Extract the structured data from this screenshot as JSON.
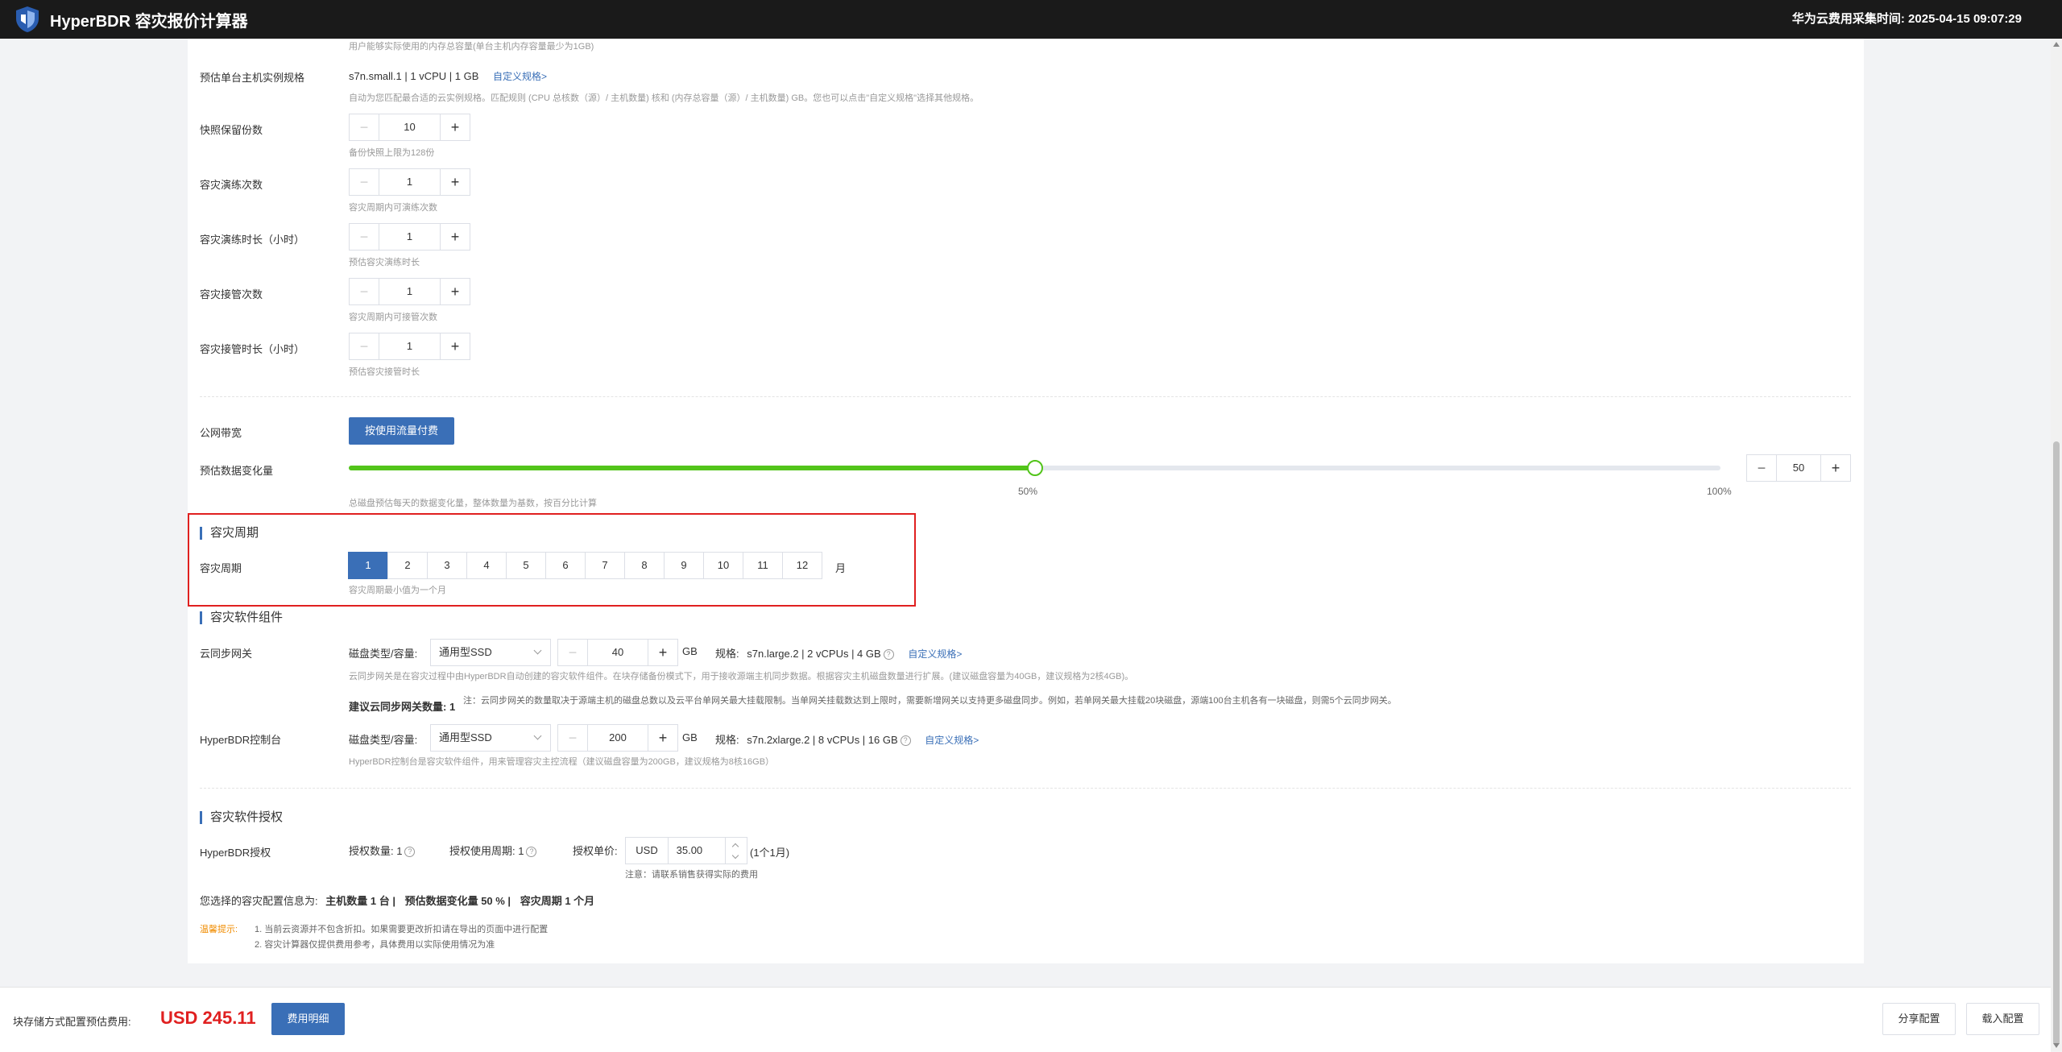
{
  "header": {
    "title": "HyperBDR 容灾报价计算器",
    "collect_time": "华为云费用采集时间: 2025-04-15 09:07:29"
  },
  "memory_hint": "用户能够实际使用的内存总容量(单台主机内存容量最少为1GB)",
  "instance": {
    "label": "预估单台主机实例规格",
    "value": "s7n.small.1 | 1 vCPU | 1 GB",
    "link": "自定义规格>",
    "hint": "自动为您匹配最合适的云实例规格。匹配规则 (CPU 总核数（源）/ 主机数量) 核和 (内存总容量（源）/ 主机数量) GB。您也可以点击\"自定义规格\"选择其他规格。"
  },
  "fields": [
    {
      "label": "快照保留份数",
      "value": "10",
      "hint": "备份快照上限为128份"
    },
    {
      "label": "容灾演练次数",
      "value": "1",
      "hint": "容灾周期内可演练次数"
    },
    {
      "label": "容灾演练时长（小时）",
      "value": "1",
      "hint": "预估容灾演练时长"
    },
    {
      "label": "容灾接管次数",
      "value": "1",
      "hint": "容灾周期内可接管次数"
    },
    {
      "label": "容灾接管时长（小时）",
      "value": "1",
      "hint": "预估容灾接管时长"
    }
  ],
  "bandwidth": {
    "label": "公网带宽",
    "button": "按使用流量付费"
  },
  "change_rate": {
    "label": "预估数据变化量",
    "percent": 50,
    "value": "50",
    "mid_label": "50%",
    "max_label": "100%",
    "hint": "总磁盘预估每天的数据变化量，整体数量为基数，按百分比计算"
  },
  "period_section": {
    "title": "容灾周期",
    "label": "容灾周期",
    "options": [
      "1",
      "2",
      "3",
      "4",
      "5",
      "6",
      "7",
      "8",
      "9",
      "10",
      "11",
      "12"
    ],
    "selected": "1",
    "unit": "月",
    "hint": "容灾周期最小值为一个月"
  },
  "components": {
    "title": "容灾软件组件",
    "gateway": {
      "label": "云同步网关",
      "disk_label": "磁盘类型/容量:",
      "disk_type": "通用型SSD",
      "size": "40",
      "unit": "GB",
      "spec_label": "规格:",
      "spec": "s7n.large.2 | 2 vCPUs | 4 GB",
      "link": "自定义规格>",
      "hint": "云同步网关是在容灾过程中由HyperBDR自动创建的容灾软件组件。在块存储备份模式下，用于接收源端主机同步数据。根据容灾主机磁盘数量进行扩展。(建议磁盘容量为40GB，建议规格为2核4GB)。",
      "count_label": "建议云同步网关数量: 1",
      "note": "注：云同步网关的数量取决于源端主机的磁盘总数以及云平台单网关最大挂载限制。当单网关挂载数达到上限时，需要新增网关以支持更多磁盘同步。例如，若单网关最大挂载20块磁盘，源端100台主机各有一块磁盘，则需5个云同步网关。"
    },
    "console": {
      "label": "HyperBDR控制台",
      "disk_label": "磁盘类型/容量:",
      "disk_type": "通用型SSD",
      "size": "200",
      "unit": "GB",
      "spec_label": "规格:",
      "spec": "s7n.2xlarge.2 | 8 vCPUs | 16 GB",
      "link": "自定义规格>",
      "hint": "HyperBDR控制台是容灾软件组件，用来管理容灾主控流程（建议磁盘容量为200GB，建议规格为8核16GB）"
    }
  },
  "license": {
    "title": "容灾软件授权",
    "label": "HyperBDR授权",
    "count_label": "授权数量: 1",
    "period_label": "授权使用周期: 1",
    "price_label": "授权单价:",
    "currency": "USD",
    "price": "35.00",
    "per": "(1个1月)",
    "note": "注意：请联系销售获得实际的费用"
  },
  "summary": {
    "prefix": "您选择的容灾配置信息为:",
    "hosts": "主机数量 1 台 |",
    "change": "预估数据变化量 50 % |",
    "period": "容灾周期 1 个月"
  },
  "tips": {
    "label": "温馨提示:",
    "line1": "1. 当前云资源并不包含折扣。如果需要更改折扣请在导出的页面中进行配置",
    "line2": "2. 容灾计算器仅提供费用参考，具体费用以实际使用情况为准"
  },
  "footer": {
    "label": "块存储方式配置预估费用:",
    "total": "USD 245.11",
    "detail_button": "费用明细",
    "share_button": "分享配置",
    "load_button": "载入配置"
  },
  "colors": {
    "primary": "#3a6fb7",
    "slider": "#52c41a",
    "total": "#e02020",
    "highlight": "#e02020",
    "tip": "#f08c00"
  }
}
